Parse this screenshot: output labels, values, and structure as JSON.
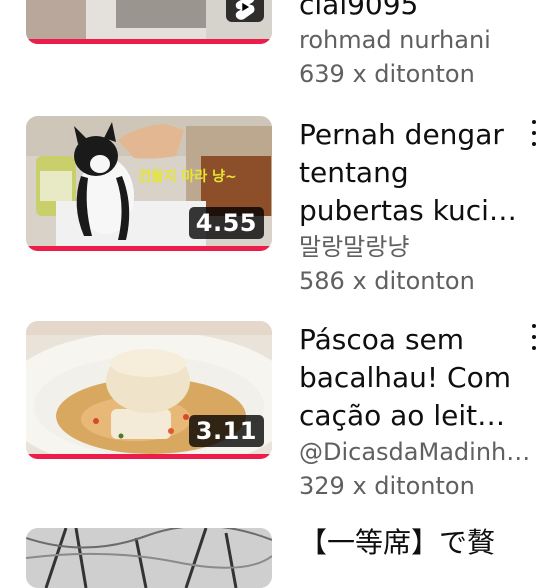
{
  "videos": [
    {
      "title_lines": [
        "cial9095"
      ],
      "channel": "rohmad nurhani",
      "views": "639 x ditonton",
      "badge": "shorts-icon",
      "progress": 1.0
    },
    {
      "title_lines": [
        "Pernah dengar",
        "tentang",
        "pubertas kuci…"
      ],
      "channel": "말랑말랑냥",
      "views": "586 x ditonton",
      "duration": "4.55",
      "thumb_text": "건들지 마라 냥~",
      "progress": 1.0
    },
    {
      "title_lines": [
        "Páscoa sem",
        "bacalhau! Com",
        "cação ao leit…"
      ],
      "channel": "@DicasdaMadinh…",
      "views": "329 x ditonton",
      "duration": "3.11",
      "progress": 1.0
    },
    {
      "title_lines": [
        "【一等席】で贅"
      ]
    }
  ],
  "colors": {
    "progress": "#ec1c4b",
    "title": "#0f0f0f",
    "meta": "#606060"
  }
}
